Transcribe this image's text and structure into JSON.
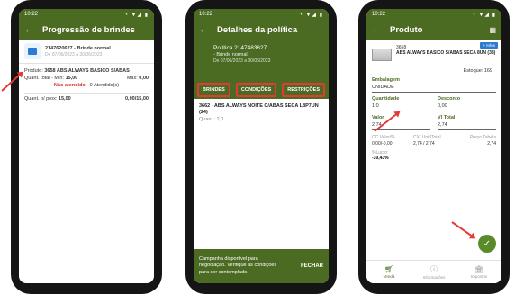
{
  "status_time": "10:22",
  "status_icons": "◔ ▼◢ ▮",
  "phone1": {
    "title": "Progressão de brindes",
    "card_code": "2147620627 - Brinde normal",
    "card_dates": "De 07/06/2023 a 30/06/2023",
    "product_label": "Produto:",
    "product_value": "3658 ABS ALWAYS BASICO S/ABAS",
    "quant_total_label": "Quant. total - Mín:",
    "quant_min": "15,00",
    "max_label": "Máx:",
    "quant_max": "0,00",
    "not_reached": "Não atendido",
    "reached": "- 0 Atendido(s)",
    "quant_prox_label": "Quant. p/ prox:",
    "quant_prox_value": "15,00",
    "quant_ratio": "0,00/15,00"
  },
  "phone2": {
    "title": "Detalhes da política",
    "policy": "Política 2147483627",
    "type": "- Brinde normal",
    "dates": "De 07/06/2023 a 30/06/2023",
    "tabs": [
      "BRINDES",
      "CONDIÇÕES",
      "RESTRIÇÕES"
    ],
    "item_name": "3662 - ABS ALWAYS NOITE C/ABAS SECA L8P7UN (24)",
    "item_qty": "Quant.: 2,0",
    "snackbar_msg": "Campanha disponível para negociação. Verifique as condições para ser contemplado.",
    "snackbar_action": "FECHAR"
  },
  "phone3": {
    "title": "Produto",
    "infos": "+ Infos",
    "product_code": "3658",
    "product_name": "ABS ALWAYS BASICO S/ABAS SECA 8UN (38)",
    "estoque": "Estoque: 169",
    "embalagem_label": "Embalagem",
    "embalagem_value": "UNIDADE",
    "quantidade_label": "Quantidade",
    "quantidade_value": "1,0",
    "desconto_label": "Desconto",
    "desconto_value": "0,00",
    "valor_label": "Valor",
    "valor_value": "2,74",
    "vl_total_label": "Vl Total:",
    "vl_total_value": "2,74",
    "cc_label": "CC Valor/%",
    "cc_value": "0,00/-0,00",
    "cx_label": "CX. Unit/Total",
    "cx_value": "2,74 / 2,74",
    "preco_label": "Preço Tabela",
    "preco_value": "2,74",
    "lucro_label": "%Lucro:",
    "lucro_value": "-10,43%",
    "nav": [
      "Venda",
      "Informações",
      "Impostos"
    ]
  }
}
